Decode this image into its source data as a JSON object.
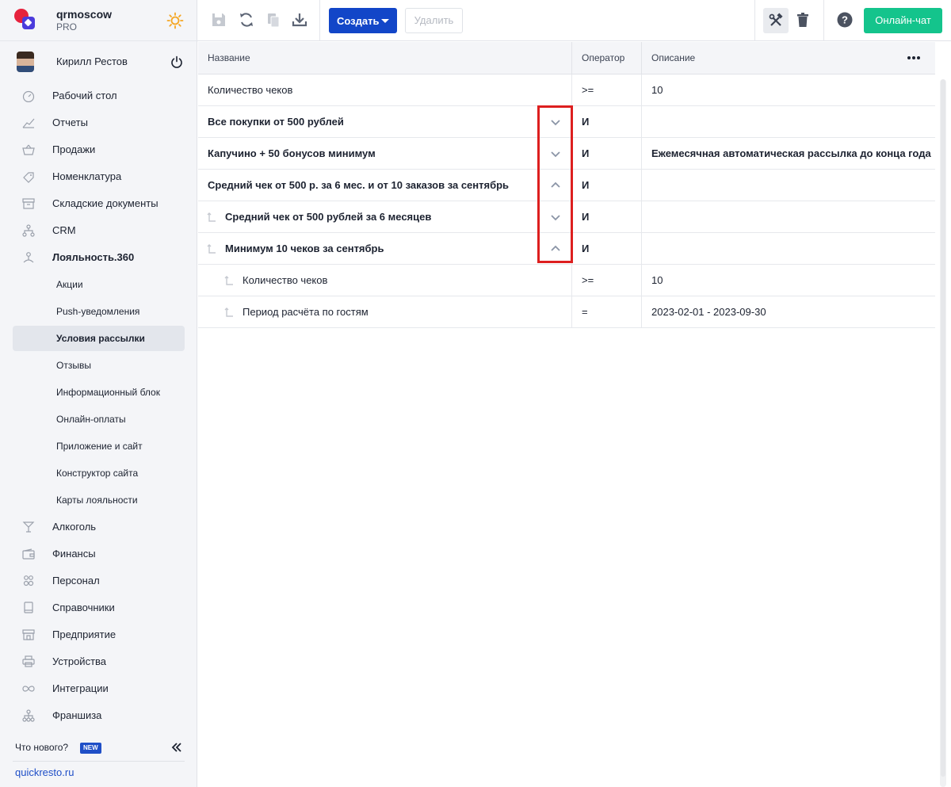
{
  "brand": {
    "name": "qrmoscow",
    "plan": "PRO"
  },
  "user": {
    "name": "Кирилл Рестов"
  },
  "sidebar": {
    "items": [
      {
        "label": "Рабочий стол",
        "icon": "dashboard-icon"
      },
      {
        "label": "Отчеты",
        "icon": "chart-icon"
      },
      {
        "label": "Продажи",
        "icon": "basket-icon"
      },
      {
        "label": "Номенклатура",
        "icon": "tag-icon"
      },
      {
        "label": "Складские документы",
        "icon": "archive-icon"
      },
      {
        "label": "CRM",
        "icon": "hierarchy-icon"
      },
      {
        "label": "Лояльность.360",
        "icon": "loyalty-icon"
      }
    ],
    "subitems": [
      {
        "label": "Акции"
      },
      {
        "label": "Push-уведомления"
      },
      {
        "label": "Условия рассылки"
      },
      {
        "label": "Отзывы"
      },
      {
        "label": "Информационный блок"
      },
      {
        "label": "Онлайн-оплаты"
      },
      {
        "label": "Приложение и сайт"
      },
      {
        "label": "Конструктор сайта"
      },
      {
        "label": "Карты лояльности"
      }
    ],
    "items2": [
      {
        "label": "Алкоголь",
        "icon": "cocktail-icon"
      },
      {
        "label": "Финансы",
        "icon": "wallet-icon"
      },
      {
        "label": "Персонал",
        "icon": "people-icon"
      },
      {
        "label": "Справочники",
        "icon": "book-icon"
      },
      {
        "label": "Предприятие",
        "icon": "store-icon"
      },
      {
        "label": "Устройства",
        "icon": "printer-icon"
      },
      {
        "label": "Интеграции",
        "icon": "infinity-icon"
      },
      {
        "label": "Франшиза",
        "icon": "network-icon"
      }
    ],
    "whats_new": "Что нового?",
    "new_badge": "NEW",
    "site_link": "quickresto.ru"
  },
  "toolbar": {
    "create_label": "Создать",
    "delete_label": "Удалить",
    "chat_label": "Онлайн-чат"
  },
  "table": {
    "columns": [
      "Название",
      "Оператор",
      "Описание"
    ],
    "rows": [
      {
        "name": "Количество чеков",
        "operator": ">=",
        "description": "10"
      },
      {
        "name": "Все покупки от 500 рублей",
        "operator": "И",
        "description": ""
      },
      {
        "name": "Капучино + 50 бонусов минимум",
        "operator": "И",
        "description": "Ежемесячная автоматическая рассылка до конца года"
      },
      {
        "name": "Средний чек от 500 р. за 6 мес. и от 10 заказов за сентябрь",
        "operator": "И",
        "description": ""
      },
      {
        "name": "Средний чек от 500 рублей за 6 месяцев",
        "operator": "И",
        "description": ""
      },
      {
        "name": "Минимум 10 чеков за сентябрь",
        "operator": "И",
        "description": ""
      },
      {
        "name": "Количество чеков",
        "operator": ">=",
        "description": "10"
      },
      {
        "name": "Период расчёта по гостям",
        "operator": "=",
        "description": "2023-02-01 - 2023-09-30"
      }
    ]
  },
  "colors": {
    "accent": "#1246c8",
    "chat": "#14c48c",
    "highlight": "#dd1f1f"
  }
}
